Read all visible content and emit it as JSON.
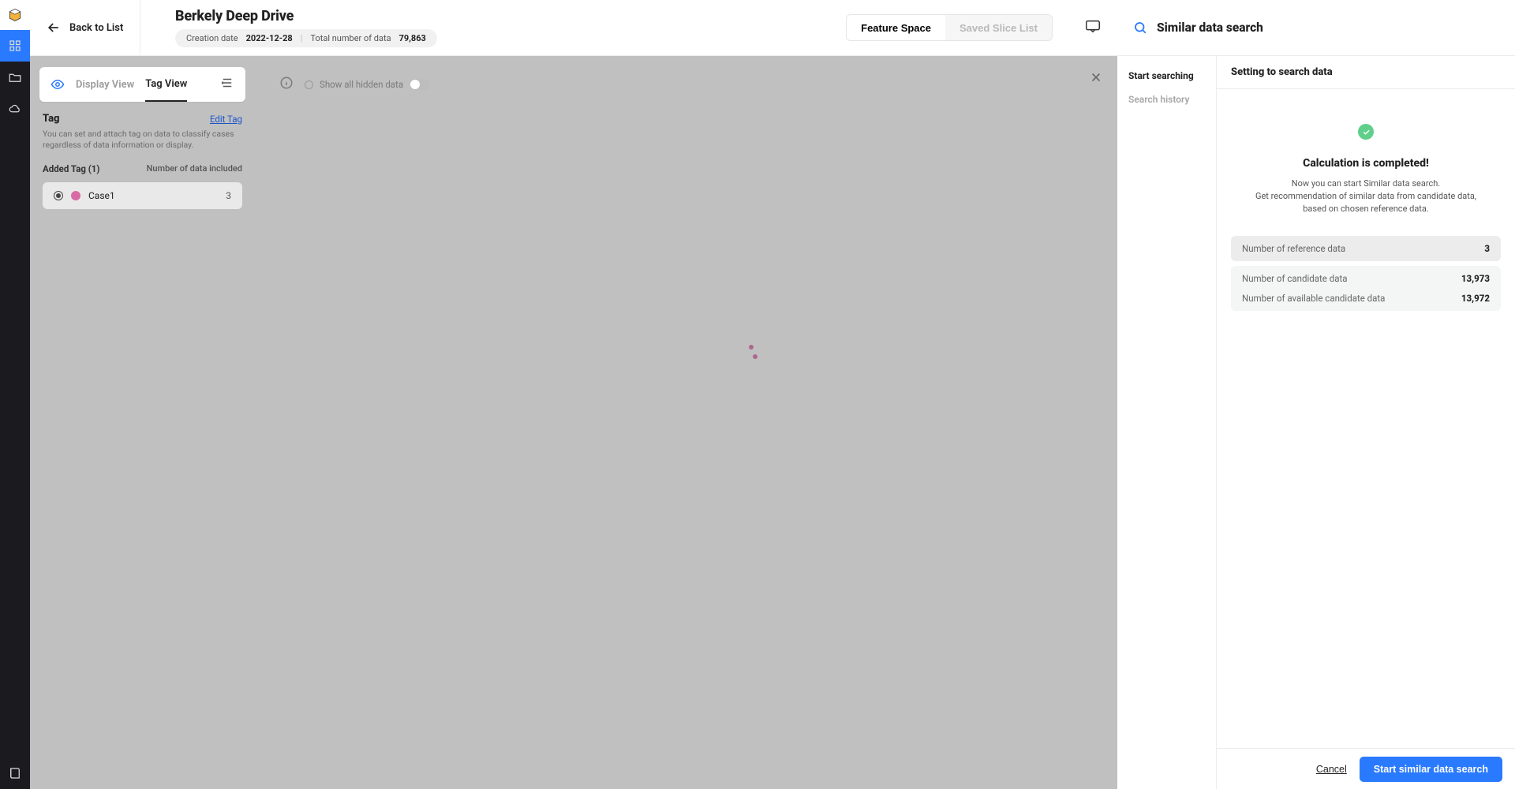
{
  "sidebar": {
    "icons": [
      "logo-icon",
      "grid-icon",
      "folder-icon",
      "cloud-icon",
      "book-icon"
    ]
  },
  "header": {
    "back_label": "Back to List",
    "title": "Berkely Deep Drive",
    "creation_label": "Creation date",
    "creation_value": "2022-12-28",
    "total_label": "Total number of data",
    "total_value": "79,863",
    "seg_a": "Feature Space",
    "seg_b": "Saved Slice List"
  },
  "view_tabs": {
    "display": "Display View",
    "tag": "Tag View"
  },
  "plot_toolbar": {
    "hidden_toggle_label": "Show all hidden data"
  },
  "tag_panel": {
    "heading": "Tag",
    "edit": "Edit Tag",
    "desc": "You can set and attach tag on data to classify cases regardless of data information or display.",
    "added_label": "Added Tag (1)",
    "count_col": "Number of data included",
    "items": [
      {
        "name": "Case1",
        "count": "3",
        "color": "#d86aa5"
      }
    ]
  },
  "drawer": {
    "title": "Similar data search",
    "nav_start": "Start searching",
    "nav_history": "Search history",
    "subhead": "Setting to search data",
    "calc_title": "Calculation is completed!",
    "calc_line1": "Now you can start Similar data search.",
    "calc_line2": "Get recommendation of similar data from candidate data,",
    "calc_line3": "based on chosen reference data.",
    "stat_ref_label": "Number of reference data",
    "stat_ref_val": "3",
    "stat_cand_label": "Number of candidate data",
    "stat_cand_val": "13,973",
    "stat_avail_label": "Number of available candidate data",
    "stat_avail_val": "13,972",
    "btn_cancel": "Cancel",
    "btn_start": "Start similar data search"
  }
}
